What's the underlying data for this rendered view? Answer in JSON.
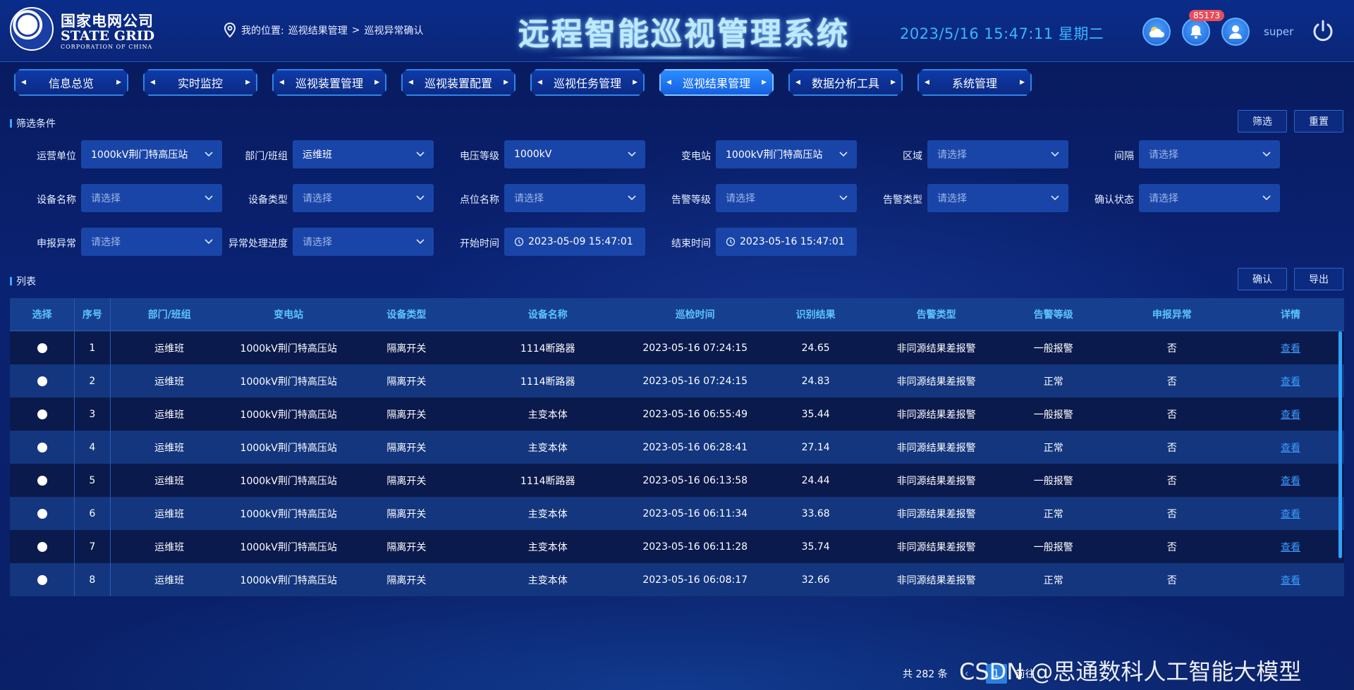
{
  "header": {
    "logo_cn": "国家电网公司",
    "logo_en": "STATE GRID",
    "logo_en_sub": "CORPORATION OF CHINA",
    "location_prefix": "我的位置:",
    "breadcrumb_1": "巡视结果管理",
    "breadcrumb_sep": ">",
    "breadcrumb_2": "巡视异常确认",
    "title": "远程智能巡视管理系统",
    "datetime": "2023/5/16 15:47:11 星期二",
    "notification_count": "85173",
    "username": "super"
  },
  "nav": [
    {
      "label": "信息总览",
      "active": false
    },
    {
      "label": "实时监控",
      "active": false
    },
    {
      "label": "巡视装置管理",
      "active": false
    },
    {
      "label": "巡视装置配置",
      "active": false
    },
    {
      "label": "巡视任务管理",
      "active": false
    },
    {
      "label": "巡视结果管理",
      "active": true
    },
    {
      "label": "数据分析工具",
      "active": false
    },
    {
      "label": "系统管理",
      "active": false
    }
  ],
  "filters": {
    "section_title": "筛选条件",
    "filter_button": "筛选",
    "reset_button": "重置",
    "fields": [
      {
        "label": "运营单位",
        "value": "1000kV荆门特高压站",
        "placeholder": false
      },
      {
        "label": "部门/班组",
        "value": "运维班",
        "placeholder": false
      },
      {
        "label": "电压等级",
        "value": "1000kV",
        "placeholder": false
      },
      {
        "label": "变电站",
        "value": "1000kV荆门特高压站",
        "placeholder": false
      },
      {
        "label": "区域",
        "value": "请选择",
        "placeholder": true
      },
      {
        "label": "间隔",
        "value": "请选择",
        "placeholder": true
      },
      {
        "label": "设备名称",
        "value": "请选择",
        "placeholder": true
      },
      {
        "label": "设备类型",
        "value": "请选择",
        "placeholder": true
      },
      {
        "label": "点位名称",
        "value": "请选择",
        "placeholder": true
      },
      {
        "label": "告警等级",
        "value": "请选择",
        "placeholder": true
      },
      {
        "label": "告警类型",
        "value": "请选择",
        "placeholder": true
      },
      {
        "label": "确认状态",
        "value": "请选择",
        "placeholder": true
      },
      {
        "label": "申报异常",
        "value": "请选择",
        "placeholder": true
      },
      {
        "label": "异常处理进度",
        "value": "请选择",
        "placeholder": true
      }
    ],
    "start_time_label": "开始时间",
    "start_time": "2023-05-09 15:47:01",
    "end_time_label": "结束时间",
    "end_time": "2023-05-16 15:47:01"
  },
  "list": {
    "section_title": "列表",
    "confirm_button": "确认",
    "export_button": "导出",
    "columns": [
      "选择",
      "序号",
      "部门/班组",
      "变电站",
      "设备类型",
      "设备名称",
      "巡检时间",
      "识别结果",
      "告警类型",
      "告警等级",
      "申报异常",
      "详情"
    ],
    "rows": [
      {
        "no": "1",
        "dept": "运维班",
        "substation": "1000kV荆门特高压站",
        "type": "隔离开关",
        "device": "1114断路器",
        "time": "2023-05-16 07:24:15",
        "result": "24.65",
        "alarm_type": "非同源结果差报警",
        "alarm_level": "一般报警",
        "reported": "否",
        "detail": "查看"
      },
      {
        "no": "2",
        "dept": "运维班",
        "substation": "1000kV荆门特高压站",
        "type": "隔离开关",
        "device": "1114断路器",
        "time": "2023-05-16 07:24:15",
        "result": "24.83",
        "alarm_type": "非同源结果差报警",
        "alarm_level": "正常",
        "reported": "否",
        "detail": "查看"
      },
      {
        "no": "3",
        "dept": "运维班",
        "substation": "1000kV荆门特高压站",
        "type": "隔离开关",
        "device": "主变本体",
        "time": "2023-05-16 06:55:49",
        "result": "35.44",
        "alarm_type": "非同源结果差报警",
        "alarm_level": "一般报警",
        "reported": "否",
        "detail": "查看"
      },
      {
        "no": "4",
        "dept": "运维班",
        "substation": "1000kV荆门特高压站",
        "type": "隔离开关",
        "device": "主变本体",
        "time": "2023-05-16 06:28:41",
        "result": "27.14",
        "alarm_type": "非同源结果差报警",
        "alarm_level": "正常",
        "reported": "否",
        "detail": "查看"
      },
      {
        "no": "5",
        "dept": "运维班",
        "substation": "1000kV荆门特高压站",
        "type": "隔离开关",
        "device": "1114断路器",
        "time": "2023-05-16 06:13:58",
        "result": "24.44",
        "alarm_type": "非同源结果差报警",
        "alarm_level": "一般报警",
        "reported": "否",
        "detail": "查看"
      },
      {
        "no": "6",
        "dept": "运维班",
        "substation": "1000kV荆门特高压站",
        "type": "隔离开关",
        "device": "主变本体",
        "time": "2023-05-16 06:11:34",
        "result": "33.68",
        "alarm_type": "非同源结果差报警",
        "alarm_level": "正常",
        "reported": "否",
        "detail": "查看"
      },
      {
        "no": "7",
        "dept": "运维班",
        "substation": "1000kV荆门特高压站",
        "type": "隔离开关",
        "device": "主变本体",
        "time": "2023-05-16 06:11:28",
        "result": "35.74",
        "alarm_type": "非同源结果差报警",
        "alarm_level": "一般报警",
        "reported": "否",
        "detail": "查看"
      },
      {
        "no": "8",
        "dept": "运维班",
        "substation": "1000kV荆门特高压站",
        "type": "隔离开关",
        "device": "主变本体",
        "time": "2023-05-16 06:08:17",
        "result": "32.66",
        "alarm_type": "非同源结果差报警",
        "alarm_level": "正常",
        "reported": "否",
        "detail": "查看"
      }
    ]
  },
  "pagination": {
    "total_text": "共 282 条",
    "current_page": "1",
    "goto_label": "前往"
  },
  "watermark": "CSDN @思通数科人工智能大模型"
}
